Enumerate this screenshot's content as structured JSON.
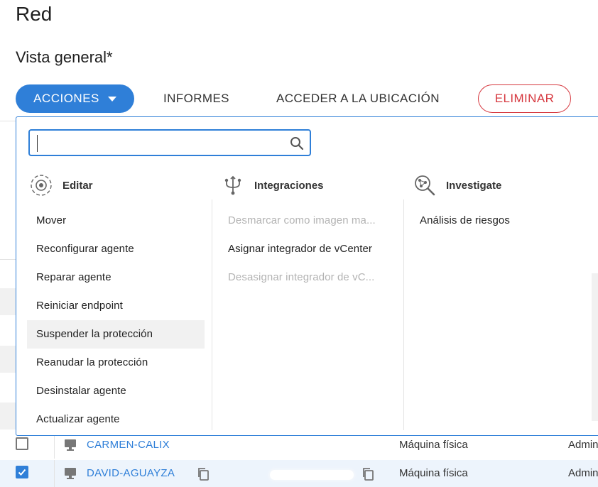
{
  "page": {
    "title": "Red",
    "subtitle": "Vista general*"
  },
  "toolbar": {
    "actions_label": "ACCIONES",
    "reports_label": "INFORMES",
    "location_label": "ACCEDER A LA UBICACIÓN",
    "delete_label": "ELIMINAR"
  },
  "dropdown": {
    "search": {
      "value": "",
      "placeholder": ""
    },
    "columns": [
      {
        "title": "Editar",
        "icon": "gear-icon",
        "items": [
          {
            "label": "Mover",
            "state": "normal"
          },
          {
            "label": "Reconfigurar agente",
            "state": "normal"
          },
          {
            "label": "Reparar agente",
            "state": "normal"
          },
          {
            "label": "Reiniciar endpoint",
            "state": "normal"
          },
          {
            "label": "Suspender la protección",
            "state": "hover"
          },
          {
            "label": "Reanudar la protección",
            "state": "normal"
          },
          {
            "label": "Desinstalar agente",
            "state": "normal"
          },
          {
            "label": "Actualizar agente",
            "state": "normal"
          }
        ]
      },
      {
        "title": "Integraciones",
        "icon": "integration-fork-icon",
        "items": [
          {
            "label": "Desmarcar como imagen ma...",
            "state": "disabled"
          },
          {
            "label": "Asignar integrador de vCenter",
            "state": "normal"
          },
          {
            "label": "Desasignar integrador de vC...",
            "state": "disabled"
          }
        ]
      },
      {
        "title": "Investigate",
        "icon": "investigate-search-icon",
        "items": [
          {
            "label": "Análisis de riesgos",
            "state": "normal"
          }
        ]
      }
    ]
  },
  "table": {
    "rows": [
      {
        "name": "CARMEN-CALIX",
        "type": "Máquina física",
        "admin": "Admin",
        "checked": false
      },
      {
        "name": "DAVID-AGUAYZA",
        "type": "Máquina física",
        "admin": "Admin",
        "checked": true
      }
    ]
  },
  "colors": {
    "accent": "#2f7fd8",
    "danger": "#d6383f",
    "hover_bg": "#f1f1f1",
    "selected_row_bg": "#edf4fc"
  }
}
